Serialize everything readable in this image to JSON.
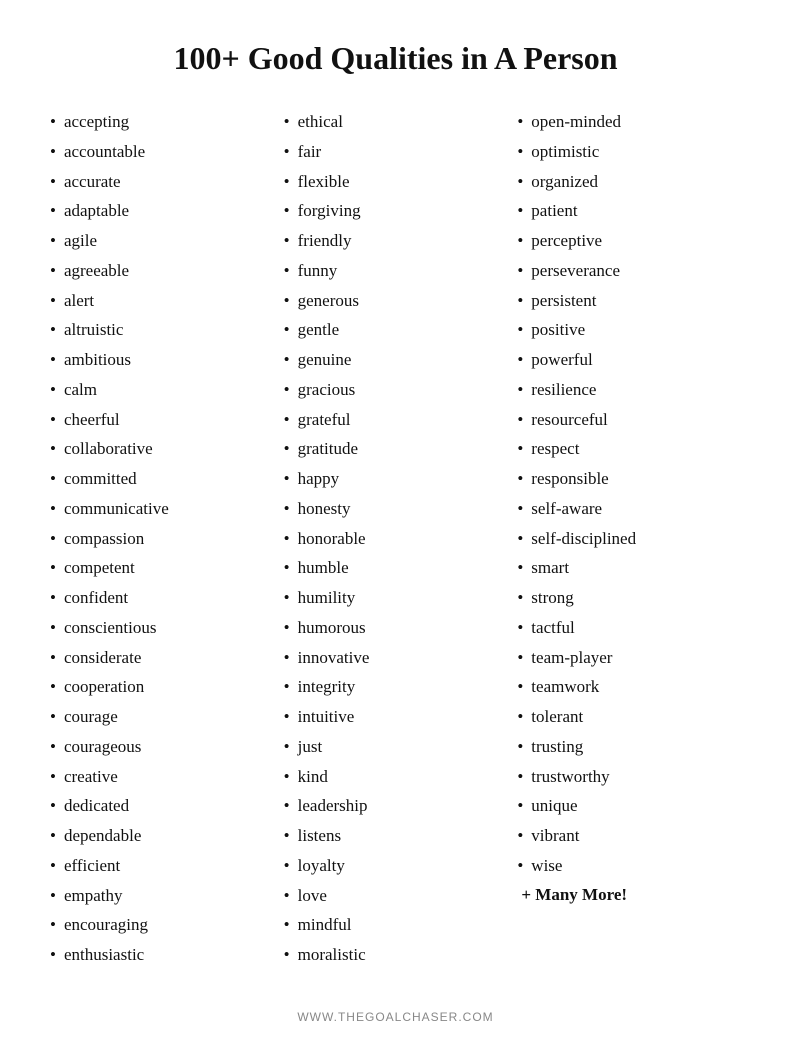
{
  "title": "100+ Good Qualities in A Person",
  "columns": [
    {
      "items": [
        "accepting",
        "accountable",
        "accurate",
        "adaptable",
        "agile",
        "agreeable",
        "alert",
        "altruistic",
        "ambitious",
        "calm",
        "cheerful",
        "collaborative",
        "committed",
        "communicative",
        "compassion",
        "competent",
        "confident",
        "conscientious",
        "considerate",
        "cooperation",
        "courage",
        "courageous",
        "creative",
        "dedicated",
        "dependable",
        "efficient",
        "empathy",
        "encouraging",
        "enthusiastic"
      ]
    },
    {
      "items": [
        "ethical",
        "fair",
        "flexible",
        "forgiving",
        "friendly",
        "funny",
        "generous",
        "gentle",
        "genuine",
        "gracious",
        "grateful",
        "gratitude",
        "happy",
        "honesty",
        "honorable",
        "humble",
        "humility",
        "humorous",
        "innovative",
        "integrity",
        "intuitive",
        "just",
        "kind",
        "leadership",
        "listens",
        "loyalty",
        "love",
        "mindful",
        "moralistic"
      ]
    },
    {
      "items": [
        "open-minded",
        "optimistic",
        "organized",
        "patient",
        "perceptive",
        "perseverance",
        "persistent",
        "positive",
        "powerful",
        "resilience",
        "resourceful",
        "respect",
        "responsible",
        "self-aware",
        "self-disciplined",
        "smart",
        "strong",
        "tactful",
        "team-player",
        "teamwork",
        "tolerant",
        "trusting",
        "trustworthy",
        "unique",
        "vibrant",
        "wise"
      ],
      "plus_more": "+ Many More!"
    }
  ],
  "footer": "WWW.THEGOALCHASER.COM"
}
